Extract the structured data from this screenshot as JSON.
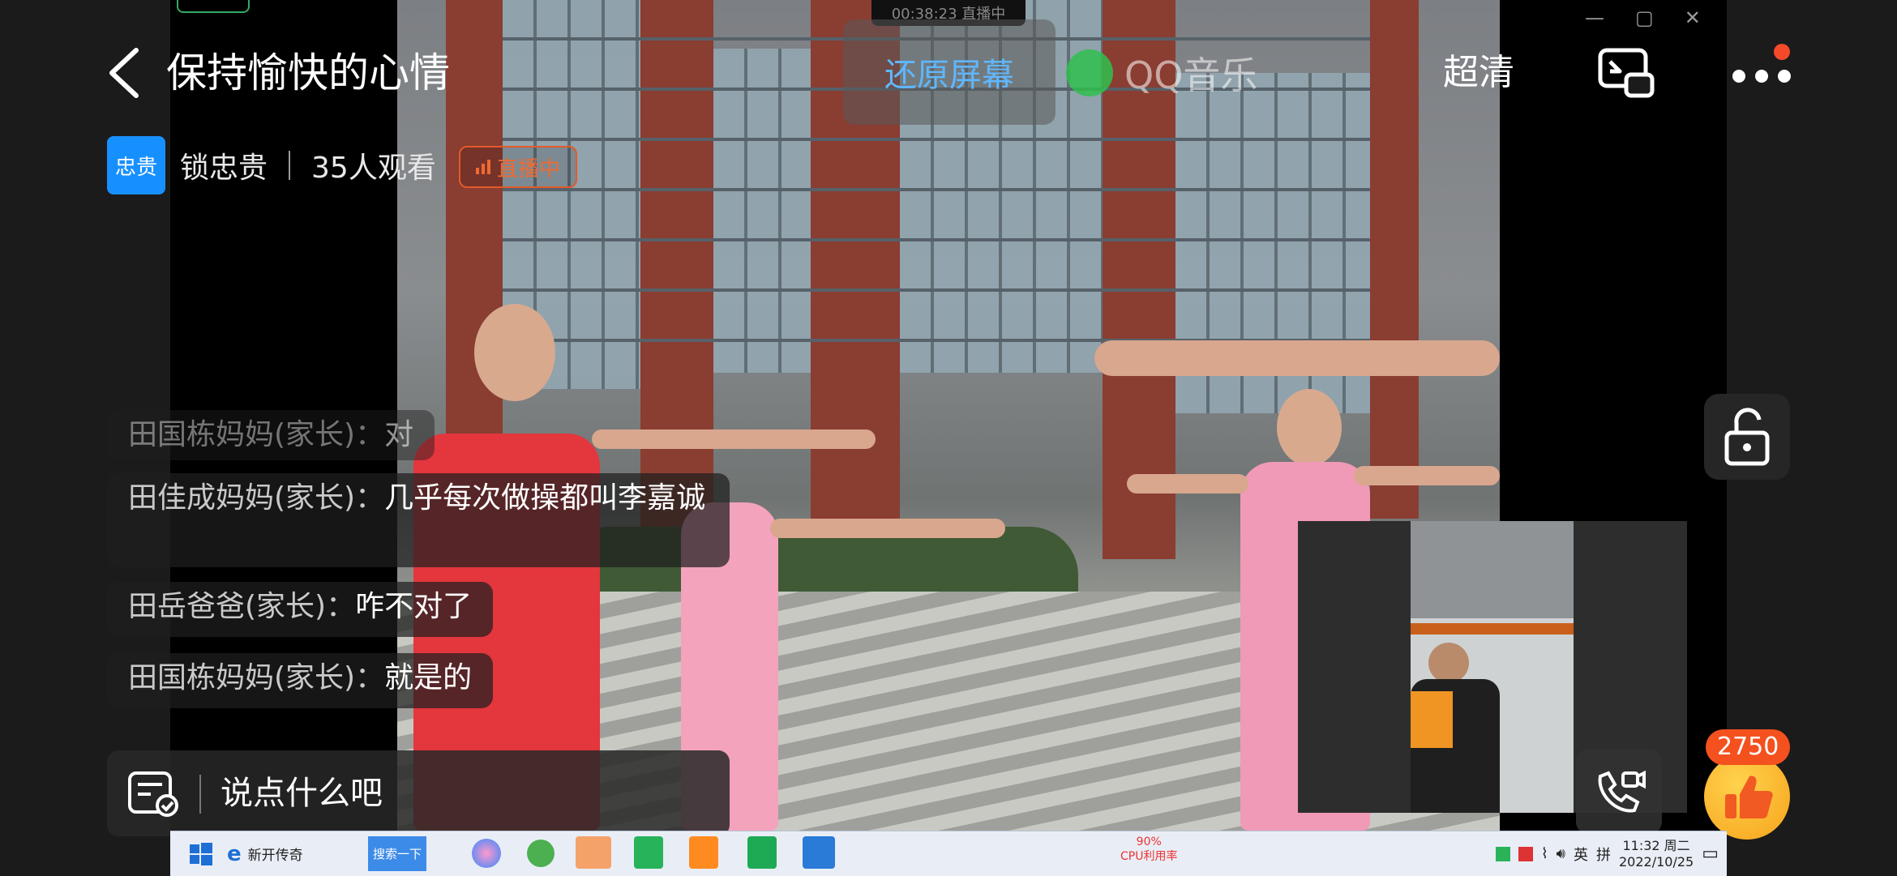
{
  "header": {
    "title": "保持愉快的心情",
    "restore_label": "还原屏幕",
    "quality_label": "超清"
  },
  "host": {
    "avatar_text": "忠贵",
    "name": "锁忠贵",
    "viewers": "35人观看",
    "live_label": "直播中"
  },
  "video": {
    "watermark": "QQ音乐",
    "rec_time": "00:38:23 直播中"
  },
  "chat": [
    {
      "name": "田国栋妈妈(家长)：",
      "text": "对"
    },
    {
      "name": "田佳成妈妈(家长)：",
      "text": "几乎每次做操都叫李嘉诚"
    },
    {
      "name": "田岳爸爸(家长)：",
      "text": "咋不对了"
    },
    {
      "name": "田国栋妈妈(家长)：",
      "text": "就是的"
    }
  ],
  "input": {
    "placeholder": "说点什么吧"
  },
  "likes": {
    "count": "2750"
  },
  "taskbar": {
    "browser_label": "新开传奇",
    "search_label": "搜索一下",
    "cpu_percent": "90%",
    "cpu_label": "CPU利用率",
    "ime_label": "英",
    "ime_mode": "拼",
    "time": "11:32 周二",
    "date": "2022/10/25"
  },
  "colors": {
    "accent_blue": "#1790ff",
    "restore_text": "#5fb7ff",
    "live_orange": "#f06a32",
    "like_badge": "#f4511e"
  },
  "icons": [
    "back-icon",
    "screen-switch-icon",
    "more-icon",
    "unlock-icon",
    "chat-list-icon",
    "video-call-icon",
    "thumbs-up-icon"
  ]
}
